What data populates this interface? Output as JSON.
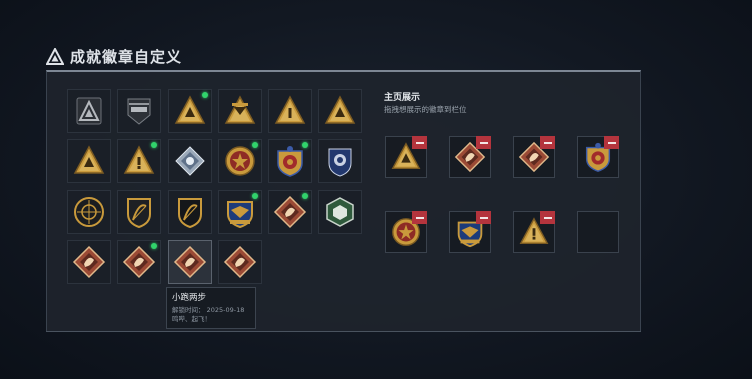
{
  "page": {
    "title": "成就徽章自定义",
    "title_icon": "warning-triangle-icon"
  },
  "panel": {
    "showcase": {
      "title": "主页展示",
      "subtitle": "拖拽想展示的徽章到栏位",
      "slots": [
        {
          "icon": "gold-triangle-tent-badge",
          "filled": true
        },
        {
          "icon": "bronze-diamond-runner-badge",
          "filled": true
        },
        {
          "icon": "bronze-diamond-dragon-badge",
          "filled": true
        },
        {
          "icon": "red-gold-shield-emblem-badge",
          "filled": true
        },
        {
          "icon": "gold-star-medallion-badge",
          "filled": true
        },
        {
          "icon": "blue-gold-eagle-shield-badge",
          "filled": true
        },
        {
          "icon": "gold-triangle-exclaim-badge",
          "filled": true
        },
        {
          "icon": "empty-slot",
          "filled": false
        }
      ],
      "remove_icon": "minus-icon"
    },
    "collection": [
      {
        "icon": "gray-triangle-badge",
        "new": false
      },
      {
        "icon": "helicopter-shield-badge",
        "new": false
      },
      {
        "icon": "gold-triangle-pack-badge",
        "new": true
      },
      {
        "icon": "gold-hourglass-badge",
        "new": false
      },
      {
        "icon": "gold-triangle-one-badge",
        "new": false
      },
      {
        "icon": "gold-triangle-eagle-badge",
        "new": false
      },
      {
        "icon": "gold-triangle-mountain-badge",
        "new": false
      },
      {
        "icon": "gold-triangle-exclaim-badge",
        "new": true
      },
      {
        "icon": "blue-crystal-diamond-badge",
        "new": false
      },
      {
        "icon": "gold-star-medallion-badge",
        "new": true
      },
      {
        "icon": "red-gold-shield-emblem-badge",
        "new": true
      },
      {
        "icon": "blue-wing-shield-badge",
        "new": false
      },
      {
        "icon": "gold-crosshair-circle-badge",
        "new": false
      },
      {
        "icon": "gold-bow-shield-badge",
        "new": false
      },
      {
        "icon": "gold-bow-shield-dark-badge",
        "new": false
      },
      {
        "icon": "blue-gold-eagle-shield-badge",
        "new": true
      },
      {
        "icon": "bronze-diamond-dragon-badge",
        "new": true
      },
      {
        "icon": "green-hexagon-badge",
        "new": false
      },
      {
        "icon": "bronze-diamond-ram-badge",
        "new": false
      },
      {
        "icon": "bronze-diamond-ram2-badge",
        "new": true
      },
      {
        "icon": "bronze-diamond-runner-badge",
        "new": false
      },
      {
        "icon": "bronze-diamond-twins-badge",
        "new": false
      }
    ],
    "tooltip": {
      "name": "小跑两步",
      "unlock_time": "解锁时间：  2025-09-18",
      "desc": "鸣哔、起飞！"
    }
  },
  "colors": {
    "remove_button": "#b4343d",
    "new_dot": "#31d36b",
    "gold": "#c99a3c",
    "bronze": "#9b4a35"
  }
}
